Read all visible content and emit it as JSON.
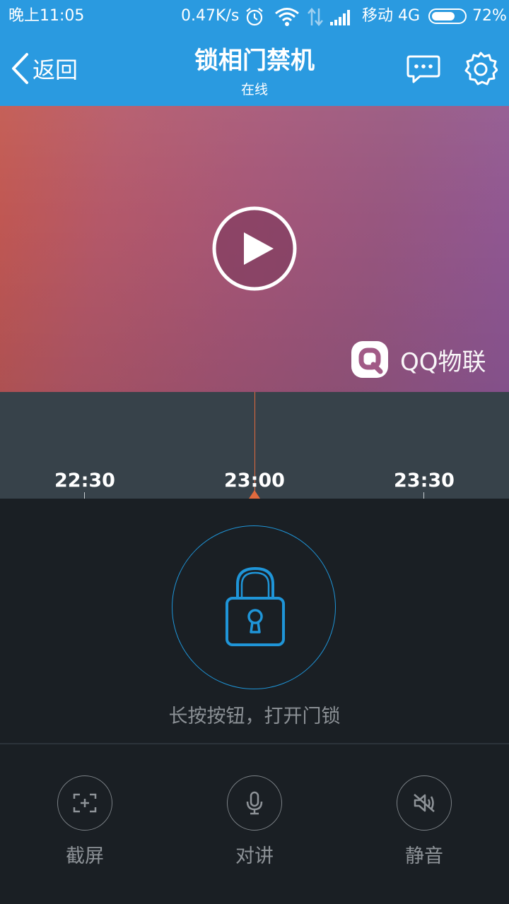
{
  "status": {
    "time": "晚上11:05",
    "speed": "0.47K/s",
    "carrier": "移动 4G",
    "battery": "72%",
    "battery_level": 0.72,
    "icons": [
      "alarm-icon",
      "wifi-icon",
      "data-arrows-icon",
      "signal-icon",
      "battery-icon"
    ]
  },
  "header": {
    "back_label": "返回",
    "title": "锁相门禁机",
    "subtitle": "在线",
    "icons": [
      "chevron-left-icon",
      "message-icon",
      "gear-icon"
    ]
  },
  "video": {
    "brand": "QQ物联",
    "icons": [
      "play-icon",
      "qq-iot-logo-icon"
    ]
  },
  "timeline": {
    "ticks": [
      "22:30",
      "23:00",
      "23:30"
    ],
    "current": "23:00"
  },
  "lock": {
    "hint": "长按按钮，打开门锁",
    "icon": "padlock-icon"
  },
  "tools": [
    {
      "label": "截屏",
      "icon": "screenshot-icon"
    },
    {
      "label": "对讲",
      "icon": "microphone-icon"
    },
    {
      "label": "静音",
      "icon": "mute-icon"
    }
  ],
  "colors": {
    "header": "#2a9ae0",
    "timeline": "#37424a",
    "panel": "#1a1f24",
    "accent": "#1f95d8",
    "cursor": "#e06a3e"
  }
}
